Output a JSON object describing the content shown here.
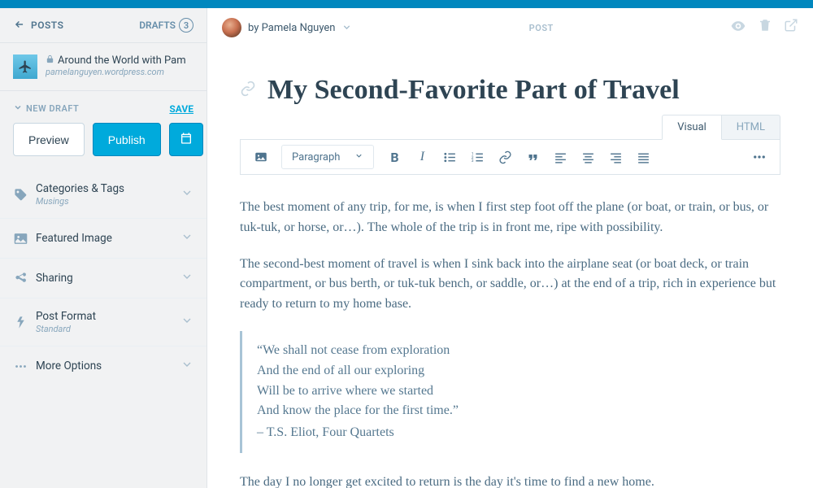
{
  "sidebar": {
    "back_label": "POSTS",
    "drafts_label": "DRAFTS",
    "drafts_count": "3",
    "site_title": "Around the World with Pam",
    "site_url": "pamelanguyen.wordpress.com",
    "new_draft": "NEW DRAFT",
    "save": "SAVE",
    "preview": "Preview",
    "publish": "Publish",
    "accordion": {
      "categories_label": "Categories & Tags",
      "categories_sub": "Musings",
      "featured_label": "Featured Image",
      "sharing_label": "Sharing",
      "format_label": "Post Format",
      "format_sub": "Standard",
      "more_label": "More Options"
    }
  },
  "header": {
    "byline_prefix": "by",
    "author": "Pamela Nguyen",
    "post_type": "POST"
  },
  "editor": {
    "title": "My Second-Favorite Part of Travel",
    "tab_visual": "Visual",
    "tab_html": "HTML",
    "paragraph_label": "Paragraph"
  },
  "content": {
    "p1": "The best moment of any trip, for me, is when I first step foot off the plane (or boat, or train, or bus, or tuk-tuk, or horse, or…). The whole of the trip is in front me, ripe with possibility.",
    "p2": "The second-best moment of travel is when I sink back into the airplane seat (or boat deck, or train compartment, or bus berth, or tuk-tuk bench, or saddle, or…) at the end of a trip, rich in experience but ready to return to my home base.",
    "quote_l1": "“We shall not cease from exploration",
    "quote_l2": "And the end of all our exploring",
    "quote_l3": "Will be to arrive where we started",
    "quote_l4": "And know the place for the first time.”",
    "quote_attr": "– T.S. Eliot, Four Quartets",
    "p3": "The day I no longer get excited to return is the day it's time to find a new home."
  }
}
